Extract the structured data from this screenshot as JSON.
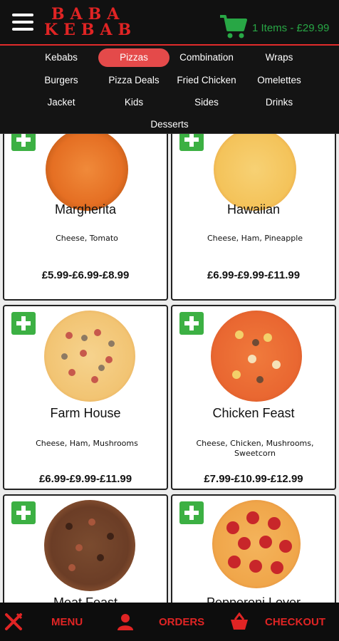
{
  "header": {
    "logo_line1": "BABA",
    "logo_line2": "KEBAB",
    "cart_text": "1 Items - £29.99"
  },
  "categories": [
    {
      "label": "Kebabs",
      "active": false
    },
    {
      "label": "Pizzas",
      "active": true
    },
    {
      "label": "Combination",
      "active": false
    },
    {
      "label": "Wraps",
      "active": false
    },
    {
      "label": "Burgers",
      "active": false
    },
    {
      "label": "Pizza Deals",
      "active": false
    },
    {
      "label": "Fried Chicken",
      "active": false
    },
    {
      "label": "Omelettes",
      "active": false
    },
    {
      "label": "Jacket",
      "active": false
    },
    {
      "label": "Kids",
      "active": false
    },
    {
      "label": "Sides",
      "active": false
    },
    {
      "label": "Drinks",
      "active": false
    },
    {
      "label": "Desserts",
      "active": false
    }
  ],
  "products": [
    {
      "name": "Margherita",
      "desc": "Cheese, Tomato",
      "price": "£5.99-£6.99-£8.99"
    },
    {
      "name": "Hawaiian",
      "desc": "Cheese, Ham, Pineapple",
      "price": "£6.99-£9.99-£11.99"
    },
    {
      "name": "Farm House",
      "desc": "Cheese, Ham, Mushrooms",
      "price": "£6.99-£9.99-£11.99"
    },
    {
      "name": "Chicken Feast",
      "desc": "Cheese, Chicken, Mushrooms, Sweetcorn",
      "price": "£7.99-£10.99-£12.99"
    },
    {
      "name": "Meat Feast",
      "desc": "",
      "price": ""
    },
    {
      "name": "Pepperoni Lover",
      "desc": "",
      "price": ""
    }
  ],
  "bottom_nav": {
    "menu_label": "MENU",
    "orders_label": "ORDERS",
    "checkout_label": "CHECKOUT"
  },
  "colors": {
    "accent_red": "#e02424",
    "cart_green": "#28a745",
    "add_green": "#3cb043",
    "active_pill": "#e44a4a"
  }
}
